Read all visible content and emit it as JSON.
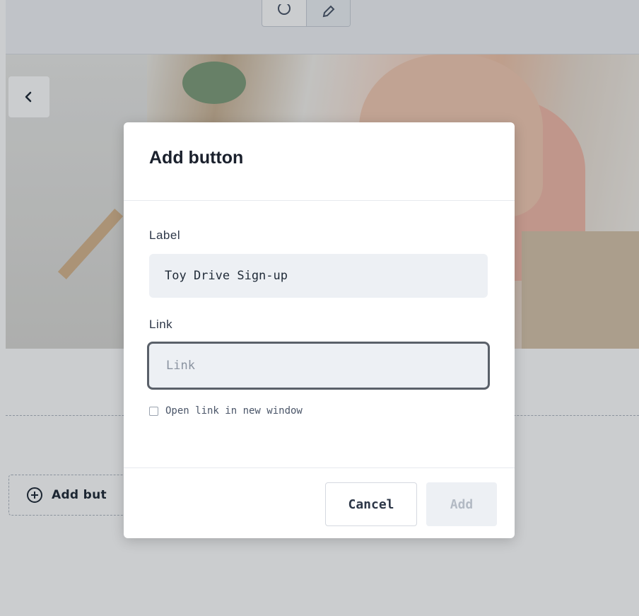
{
  "modal": {
    "title": "Add button",
    "label_field": {
      "label": "Label",
      "value": "Toy Drive Sign-up"
    },
    "link_field": {
      "label": "Link",
      "value": "",
      "placeholder": "Link"
    },
    "new_window_checkbox": {
      "label": "Open link in new window",
      "checked": false
    },
    "cancel_label": "Cancel",
    "add_label": "Add"
  },
  "background": {
    "add_button_label": "Add but"
  },
  "icons": {
    "back": "chevron-left-icon",
    "add": "plus-circle-icon",
    "toolbar_left": "clock-icon",
    "toolbar_right": "pencil-icon"
  },
  "colors": {
    "overlay": "#000000",
    "input_bg": "#edf0f4",
    "focus_border": "#5a6069",
    "disabled_text": "#b3bac4"
  }
}
